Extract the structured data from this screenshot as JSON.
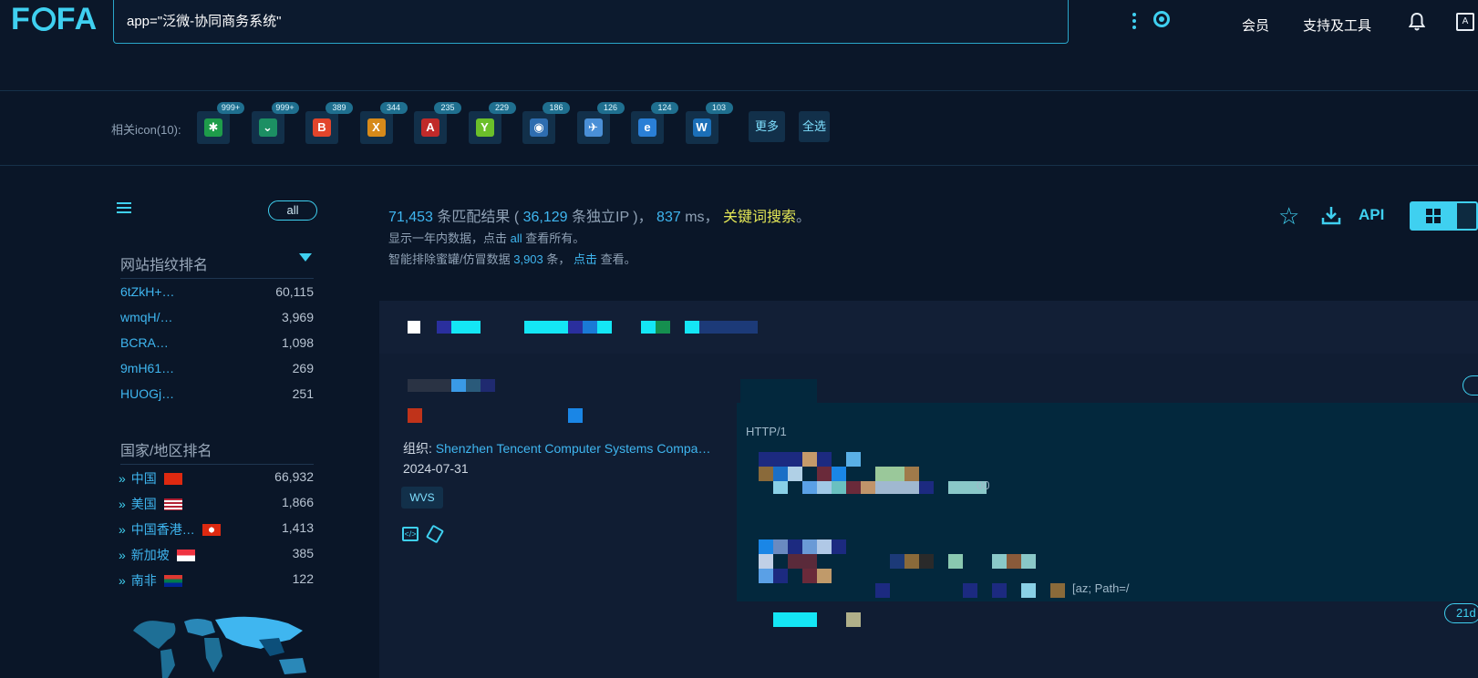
{
  "header": {
    "logo": "FOFA",
    "query": "app=\"泛微-协同商务系统\"",
    "nav": {
      "member": "会员",
      "support": "支持及工具"
    },
    "lang_icon_text": "A"
  },
  "related_icons": {
    "label": "相关icon(10):",
    "items": [
      {
        "badge": "999+",
        "name": "star-flower-icon",
        "color": "#1e9c4a"
      },
      {
        "badge": "999+",
        "name": "chevron-shield-icon",
        "color": "#1c8f63"
      },
      {
        "badge": "389",
        "name": "red-b-icon",
        "color": "#e2452b"
      },
      {
        "badge": "344",
        "name": "x-tile-icon",
        "color": "#d68a1a"
      },
      {
        "badge": "235",
        "name": "red-a-icon",
        "color": "#c02a2a"
      },
      {
        "badge": "229",
        "name": "sprout-icon",
        "color": "#6bbf2a"
      },
      {
        "badge": "186",
        "name": "eye-icon",
        "color": "#2e6db0"
      },
      {
        "badge": "126",
        "name": "bird-icon",
        "color": "#4a8fd6"
      },
      {
        "badge": "124",
        "name": "blue-e-icon",
        "color": "#2a7fd6"
      },
      {
        "badge": "103",
        "name": "double-u-icon",
        "color": "#1b6fb8"
      }
    ],
    "more": "更多",
    "select_all": "全选"
  },
  "sidebar": {
    "all_label": "all",
    "fingerprint_title": "网站指纹排名",
    "fingerprints": [
      {
        "name": "6tZkH+…",
        "count": "60,115"
      },
      {
        "name": "wmqH/…",
        "count": "3,969"
      },
      {
        "name": "BCRA…",
        "count": "1,098"
      },
      {
        "name": "9mH61…",
        "count": "269"
      },
      {
        "name": "HUOGj…",
        "count": "251"
      }
    ],
    "country_title": "国家/地区排名",
    "countries": [
      {
        "name": "中国",
        "count": "66,932",
        "flag": "cn"
      },
      {
        "name": "美国",
        "count": "1,866",
        "flag": "us"
      },
      {
        "name": "中国香港…",
        "count": "1,413",
        "flag": "hk"
      },
      {
        "name": "新加坡",
        "count": "385",
        "flag": "sg"
      },
      {
        "name": "南非",
        "count": "122",
        "flag": "za"
      }
    ]
  },
  "summary": {
    "total": "71,453",
    "total_suffix": " 条匹配结果 ( ",
    "ips": "36,129",
    "ips_suffix": " 条独立IP )， ",
    "ms": "837",
    "ms_suffix": " ms， ",
    "keyword": "关键词搜索",
    "end": "。",
    "line2_a": "显示一年内数据，点击 ",
    "line2_link": "all",
    "line2_b": " 查看所有。",
    "line3_a": "智能排除蜜罐/仿冒数据 ",
    "line3_num": "3,903",
    "line3_b": " 条， ",
    "line3_link": "点击",
    "line3_c": " 查看。",
    "api": "API"
  },
  "result": {
    "org_label": "组织: ",
    "org_value": "Shenzhen Tencent Computer Systems Compa…",
    "date": "2024-07-31",
    "tag": "WVS",
    "http_prefix": "HTTP/1",
    "frag_status": "00",
    "frag_cookie": "[az; Path=/",
    "age": "21d"
  }
}
